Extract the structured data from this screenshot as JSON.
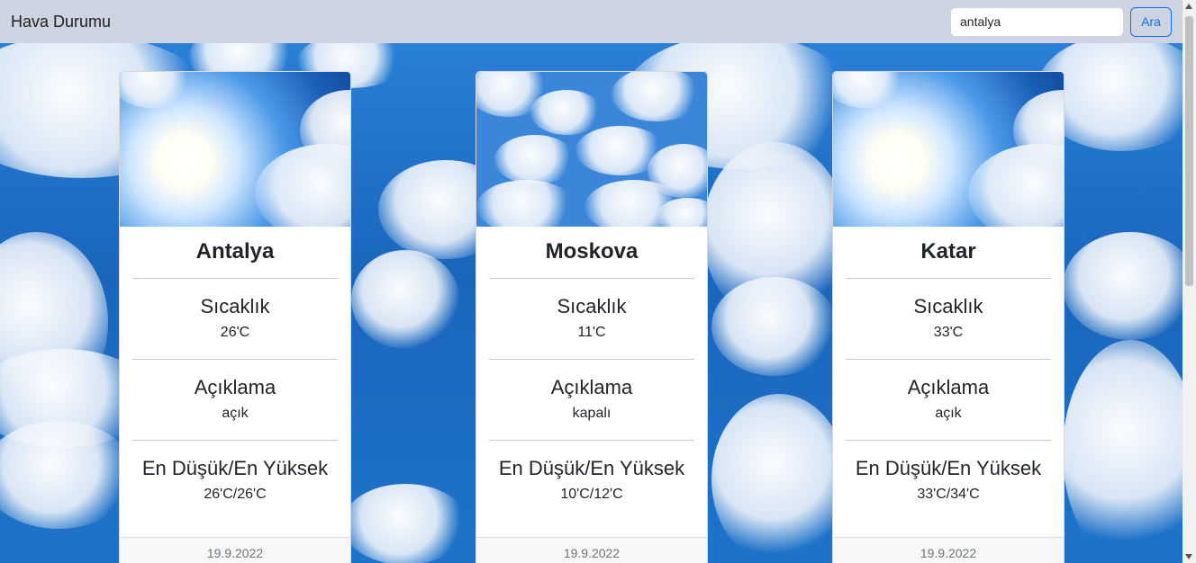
{
  "navbar": {
    "brand": "Hava Durumu",
    "search_value": "antalya",
    "search_button": "Ara"
  },
  "cards": [
    {
      "city": "Antalya",
      "temp_label": "Sıcaklık",
      "temp": "26'C",
      "desc_label": "Açıklama",
      "desc": "açık",
      "range_label": "En Düşük/En Yüksek",
      "range": "26'C/26'C",
      "date": "19.9.2022"
    },
    {
      "city": "Moskova",
      "temp_label": "Sıcaklık",
      "temp": "11'C",
      "desc_label": "Açıklama",
      "desc": "kapalı",
      "range_label": "En Düşük/En Yüksek",
      "range": "10'C/12'C",
      "date": "19.9.2022"
    },
    {
      "city": "Katar",
      "temp_label": "Sıcaklık",
      "temp": "33'C",
      "desc_label": "Açıklama",
      "desc": "açık",
      "range_label": "En Düşük/En Yüksek",
      "range": "33'C/34'C",
      "date": "19.9.2022"
    }
  ],
  "colors": {
    "navbar_bg": "#cdd3e0",
    "accent": "#0d6efd",
    "sky": "#1b6fc4"
  }
}
